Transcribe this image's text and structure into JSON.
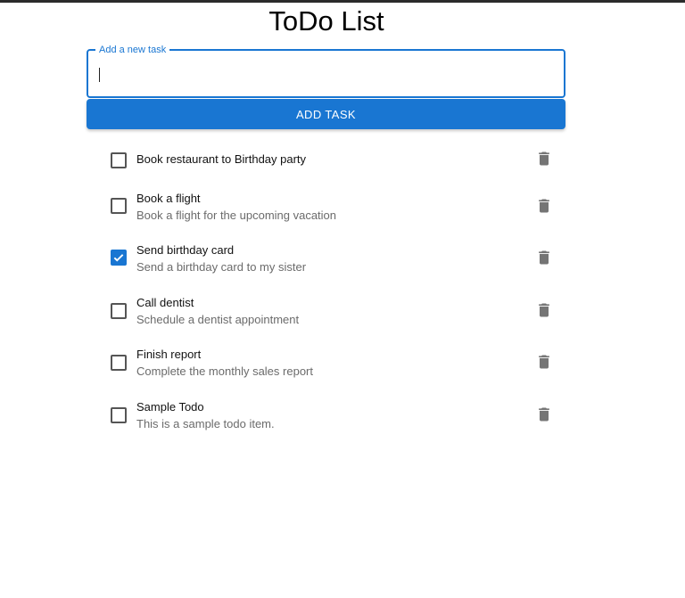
{
  "app": {
    "title": "ToDo List"
  },
  "new_task": {
    "label": "Add a new task",
    "value": "",
    "placeholder": ""
  },
  "add_button": {
    "label": "ADD TASK"
  },
  "todos": [
    {
      "title": "Book restaurant to Birthday party",
      "description": "",
      "checked": false,
      "icon": "delete-icon"
    },
    {
      "title": "Book a flight",
      "description": "Book a flight for the upcoming vacation",
      "checked": false,
      "icon": "delete-icon"
    },
    {
      "title": "Send birthday card",
      "description": "Send a birthday card to my sister",
      "checked": true,
      "icon": "delete-icon"
    },
    {
      "title": "Call dentist",
      "description": "Schedule a dentist appointment",
      "checked": false,
      "icon": "delete-icon"
    },
    {
      "title": "Finish report",
      "description": "Complete the monthly sales report",
      "checked": false,
      "icon": "delete-icon"
    },
    {
      "title": "Sample Todo",
      "description": "This is a sample todo item.",
      "checked": false,
      "icon": "delete-icon"
    }
  ],
  "colors": {
    "primary": "#1976d2",
    "icon": "#757575"
  }
}
